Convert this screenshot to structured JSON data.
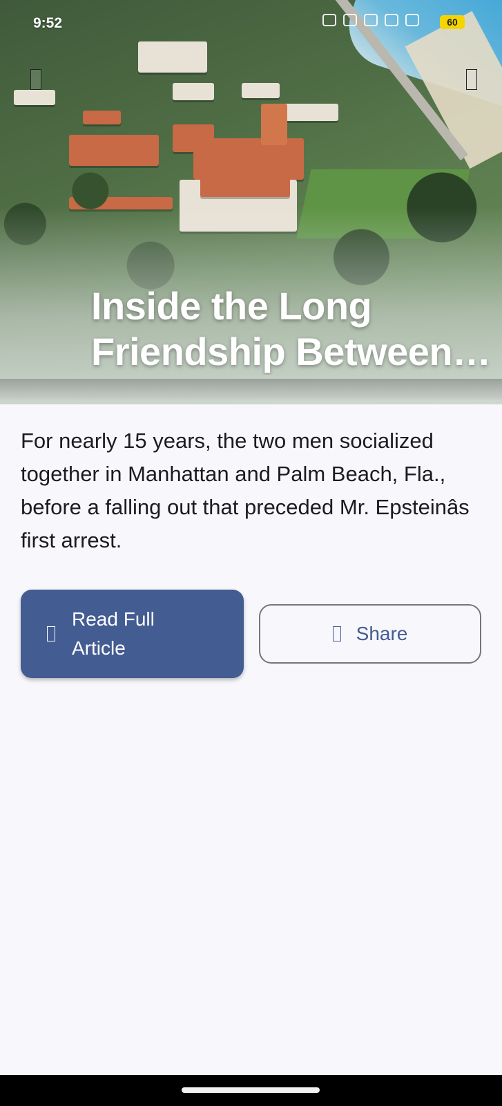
{
  "status_bar": {
    "time": "9:52",
    "battery_level": "60",
    "battery_color": "#f5d400",
    "icons": [
      "nfc-icon",
      "mute-icon",
      "call-icon",
      "data-speed-icon",
      "wifi-icon",
      "signal-icon",
      "signal-icon-2"
    ]
  },
  "hero": {
    "image": "aerial-estate-photo",
    "title": "Inside the Long Friendship Between T..."
  },
  "article": {
    "summary": "For nearly 15 years, the two men socialized together in Manhattan and Palm Beach, Fla., before a falling out that preceded Mr. Epsteinâs first arrest."
  },
  "actions": {
    "read_full_label": "Read Full Article",
    "share_label": "Share"
  },
  "colors": {
    "primary": "#435c91",
    "background": "#f8f7fc",
    "outline": "#75757d"
  }
}
